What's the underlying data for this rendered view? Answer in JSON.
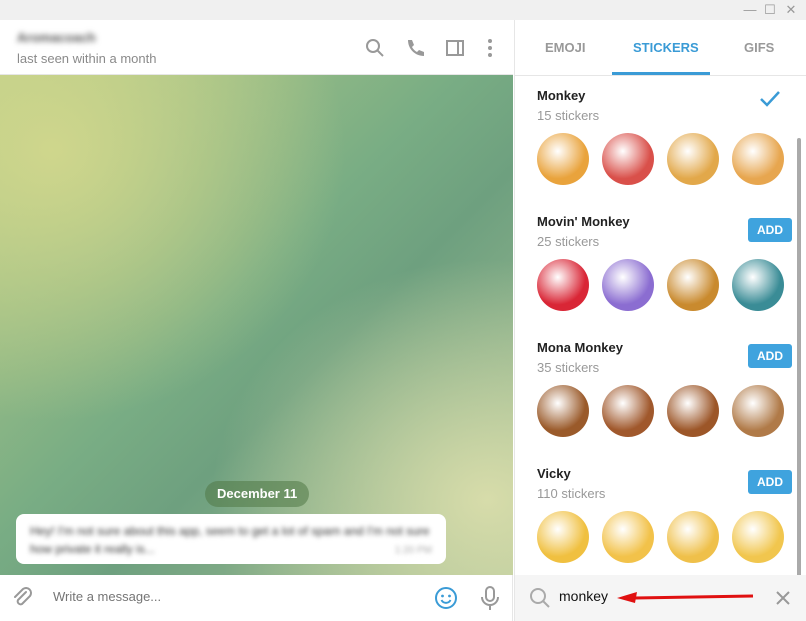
{
  "window": {
    "minimize": "—",
    "maximize": "☐",
    "close": "✕"
  },
  "chat": {
    "contact_name": "Aromacoach",
    "status": "last seen within a month",
    "date_badge": "December 11",
    "message": {
      "text": "Hey! I'm not sure about this app, seem to get a lot of spam and I'm not sure how private it really is...",
      "time": "1:20 PM"
    },
    "input_placeholder": "Write a message..."
  },
  "panel": {
    "tabs": [
      {
        "label": "EMOJI"
      },
      {
        "label": "STICKERS",
        "active": true
      },
      {
        "label": "GIFS"
      }
    ],
    "sets": [
      {
        "title": "Monkey",
        "count": "15 stickers",
        "installed": true,
        "colors": [
          "#e9a33c",
          "#d9504a",
          "#e2a84a",
          "#e7a64f"
        ]
      },
      {
        "title": "Movin' Monkey",
        "count": "25 stickers",
        "add_label": "ADD",
        "colors": [
          "#d92636",
          "#8b6dd1",
          "#c98a2e",
          "#3a8c96"
        ]
      },
      {
        "title": "Mona Monkey",
        "count": "35 stickers",
        "add_label": "ADD",
        "colors": [
          "#9a5a2a",
          "#a0582c",
          "#9c5628",
          "#b07a48"
        ]
      },
      {
        "title": "Vicky",
        "count": "110 stickers",
        "add_label": "ADD",
        "colors": [
          "#f0c040",
          "#f2c24a",
          "#efc04a",
          "#f1c64e"
        ]
      }
    ],
    "search_value": "monkey"
  },
  "colors": {
    "accent": "#3a9bd6",
    "arrow": "#e01010"
  }
}
